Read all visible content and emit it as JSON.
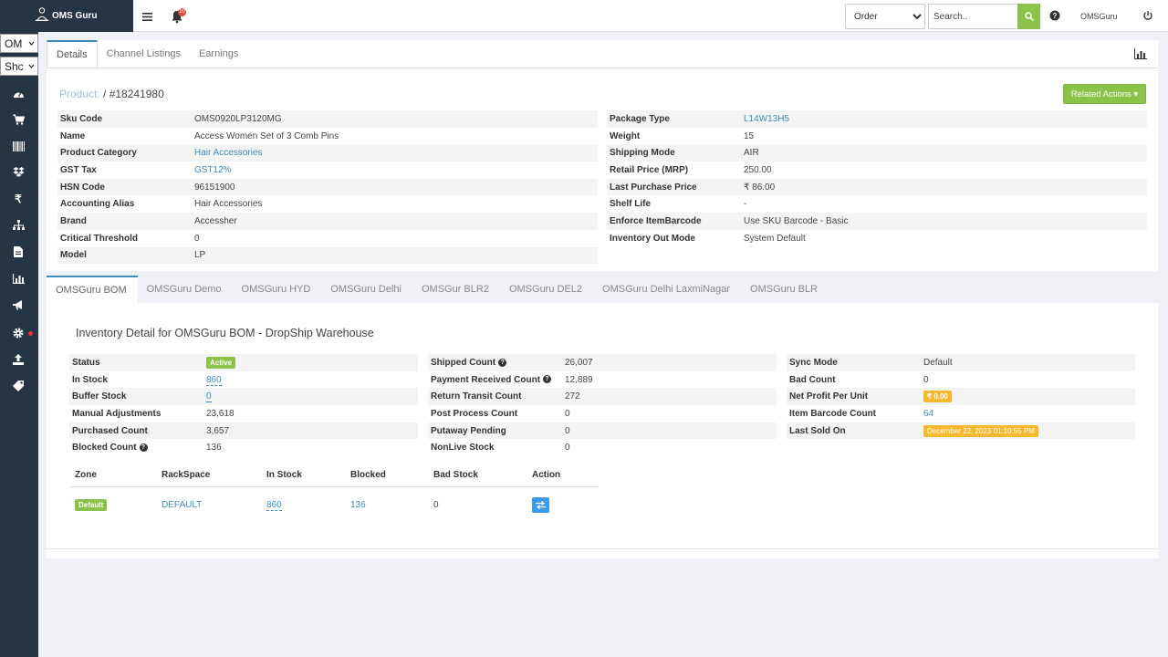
{
  "app": {
    "brand": "OMS Guru",
    "notification_count": "10"
  },
  "search": {
    "scope": "Order",
    "scope_options": [
      "Order"
    ],
    "placeholder": "Search.."
  },
  "user": {
    "name": "OMSGuru"
  },
  "sidebar": {
    "select_1": "OM",
    "select_2": "Shc",
    "icons": [
      "dashboard-icon",
      "cart-icon",
      "barcode-icon",
      "dropbox-icon",
      "rupee-icon",
      "sitemap-icon",
      "file-icon",
      "bar-chart-icon",
      "bullhorn-icon",
      "settings-icon",
      "upload-icon",
      "tag-icon"
    ]
  },
  "top_tabs": [
    "Details",
    "Channel Listings",
    "Earnings"
  ],
  "product": {
    "prefix": "Product:",
    "id": " / #18241980"
  },
  "related_actions": "Related Actions ▾",
  "details_left": [
    {
      "label": "Sku Code",
      "value": "OMS0920LP3120MG",
      "link": false
    },
    {
      "label": "Name",
      "value": "Access Women Set of 3 Comb Pins",
      "link": false
    },
    {
      "label": "Product Category",
      "value": "Hair Accessories",
      "link": true
    },
    {
      "label": "GST Tax",
      "value": "GST12%",
      "link": true
    },
    {
      "label": "HSN Code",
      "value": "96151900",
      "link": false
    },
    {
      "label": "Accounting Alias",
      "value": "Hair Accessories",
      "link": false
    },
    {
      "label": "Brand",
      "value": "Accessher",
      "link": false
    },
    {
      "label": "Critical Threshold",
      "value": "0",
      "link": false
    },
    {
      "label": "Model",
      "value": "LP",
      "link": false
    }
  ],
  "details_right": [
    {
      "label": "Package Type",
      "value": "L14W13H5",
      "link": true
    },
    {
      "label": "Weight",
      "value": "15",
      "link": false
    },
    {
      "label": "Shipping Mode",
      "value": "AIR",
      "link": false
    },
    {
      "label": "Retail Price (MRP)",
      "value": "250.00",
      "link": false
    },
    {
      "label": "Last Purchase Price",
      "value": "₹ 86.00",
      "link": false
    },
    {
      "label": "Shelf Life",
      "value": "-",
      "link": false
    },
    {
      "label": "Enforce ItemBarcode",
      "value": "Use SKU Barcode - Basic",
      "link": false
    },
    {
      "label": "Inventory Out Mode",
      "value": "System Default",
      "link": false
    }
  ],
  "warehouse_tabs": [
    "OMSGuru BOM",
    "OMSGuru Demo",
    "OMSGuru HYD",
    "OMSGuru Delhi",
    "OMSGur BLR2",
    "OMSGuru DEL2",
    "OMSGuru Delhi LaxmiNagar",
    "OMSGuru BLR"
  ],
  "inventory": {
    "title": "Inventory Detail for OMSGuru BOM - DropShip Warehouse",
    "col1": [
      {
        "label": "Status",
        "value": "Active"
      },
      {
        "label": "In Stock",
        "value": "860"
      },
      {
        "label": "Buffer Stock",
        "value": "0"
      },
      {
        "label": "Manual Adjustments",
        "value": "23,618"
      },
      {
        "label": "Purchased Count",
        "value": "3,657"
      },
      {
        "label": "Blocked Count",
        "value": "136"
      }
    ],
    "col2": [
      {
        "label": "Shipped Count",
        "value": "26,007"
      },
      {
        "label": "Payment Received Count",
        "value": "12,889"
      },
      {
        "label": "Return Transit Count",
        "value": "272"
      },
      {
        "label": "Post Process Count",
        "value": "0"
      },
      {
        "label": "Putaway Pending",
        "value": "0"
      },
      {
        "label": "NonLive Stock",
        "value": "0"
      }
    ],
    "col3": [
      {
        "label": "Sync Mode",
        "value": "Default"
      },
      {
        "label": "Bad Count",
        "value": "0"
      },
      {
        "label": "Net Profit Per Unit",
        "value": "₹ 0.00"
      },
      {
        "label": "Item Barcode Count",
        "value": "64"
      },
      {
        "label": "Last Sold On",
        "value": "December 22, 2023 01:10:55 PM"
      }
    ]
  },
  "zone_table": {
    "headers": [
      "Zone",
      "RackSpace",
      "In Stock",
      "Blocked",
      "Bad Stock",
      "Action"
    ],
    "row": {
      "zone": "Default",
      "rackspace": "DEFAULT",
      "in_stock": "860",
      "blocked": "136",
      "bad_stock": "0"
    }
  },
  "colors": {
    "accent": "#3c8dbc",
    "green": "#8bc34a",
    "amber": "#f5b82e",
    "sidebar": "#263544"
  }
}
